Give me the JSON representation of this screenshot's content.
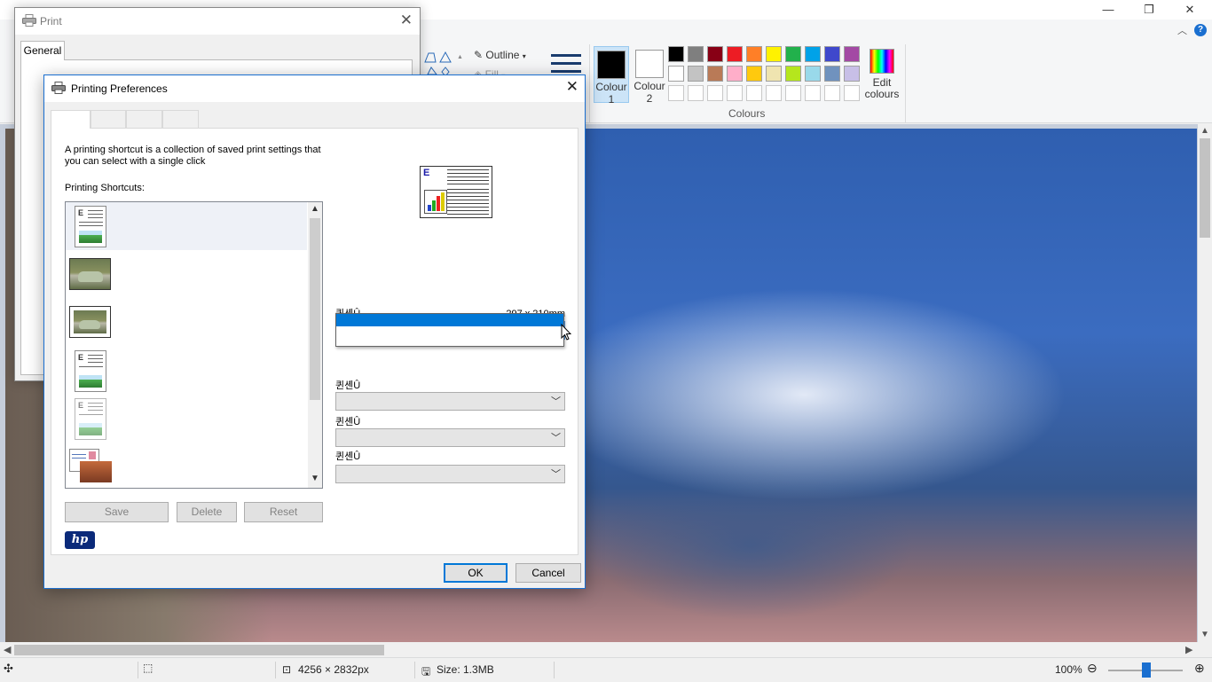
{
  "paint": {
    "window_controls": {
      "minimize": "—",
      "restore": "❐",
      "close": "✕"
    },
    "ribbon": {
      "outline_label": "Outline",
      "fill_label": "Fill",
      "colour1_label_line1": "Colour",
      "colour1_label_line2": "1",
      "colour2_label_line1": "Colour",
      "colour2_label_line2": "2",
      "edit_colours_line1": "Edit",
      "edit_colours_line2": "colours",
      "colours_group_label": "Colours",
      "colour1_value": "#000000",
      "colour2_value": "#ffffff",
      "palette_row1": [
        "#000000",
        "#7f7f7f",
        "#880015",
        "#ed1c24",
        "#ff7f27",
        "#fff200",
        "#22b14c",
        "#00a2e8",
        "#3f48cc",
        "#a349a4"
      ],
      "palette_row2": [
        "#ffffff",
        "#c3c3c3",
        "#b97a57",
        "#ffaec9",
        "#ffc90e",
        "#efe4b0",
        "#b5e61d",
        "#99d9ea",
        "#7092be",
        "#c8bfe7"
      ],
      "palette_row3": [
        "#ffffff",
        "#ffffff",
        "#ffffff",
        "#ffffff",
        "#ffffff",
        "#ffffff",
        "#ffffff",
        "#ffffff",
        "#ffffff",
        "#ffffff"
      ]
    },
    "status": {
      "image_size": "4256 × 2832px",
      "file_size": "Size: 1.3MB",
      "zoom": "100%"
    }
  },
  "print_dialog": {
    "title": "Print",
    "tab_general": "General"
  },
  "prefs_dialog": {
    "title": "Printing Preferences",
    "intro_text": "A printing shortcut is a collection of saved print settings that you can select with a single click",
    "shortcuts_label": "Printing Shortcuts:",
    "shortcut_items": [
      "document",
      "photo-borderless",
      "photo-bordered",
      "document-duplex",
      "document-economy",
      "postcard"
    ],
    "save_label": "Save",
    "delete_label": "Delete",
    "reset_label": "Reset",
    "hp_logo": "hp",
    "paper_size_label": "퀸셴Û",
    "paper_size_value": "297 x 210mm",
    "field2_label": "퀸셴Û",
    "field3_label": "퀸셴Û",
    "field4_label": "퀸셴Û",
    "ok_label": "OK",
    "cancel_label": "Cancel"
  }
}
